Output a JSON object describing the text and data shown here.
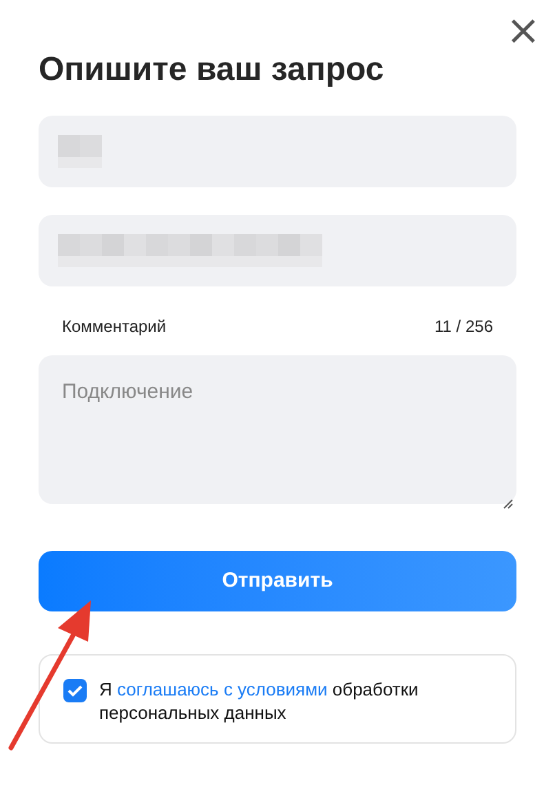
{
  "dialog": {
    "title": "Опишите ваш запрос",
    "close": "×"
  },
  "fields": [
    {
      "kind": "blurred"
    },
    {
      "kind": "blurred"
    }
  ],
  "comment": {
    "label": "Комментарий",
    "counter": "11 / 256",
    "placeholder": "Подключение"
  },
  "submit": {
    "label": "Отправить"
  },
  "consent": {
    "checked": true,
    "before": "Я",
    "link": "соглашаюсь с условиями",
    "after": "обработки персональных данных"
  },
  "annotation": {
    "kind": "arrow"
  }
}
